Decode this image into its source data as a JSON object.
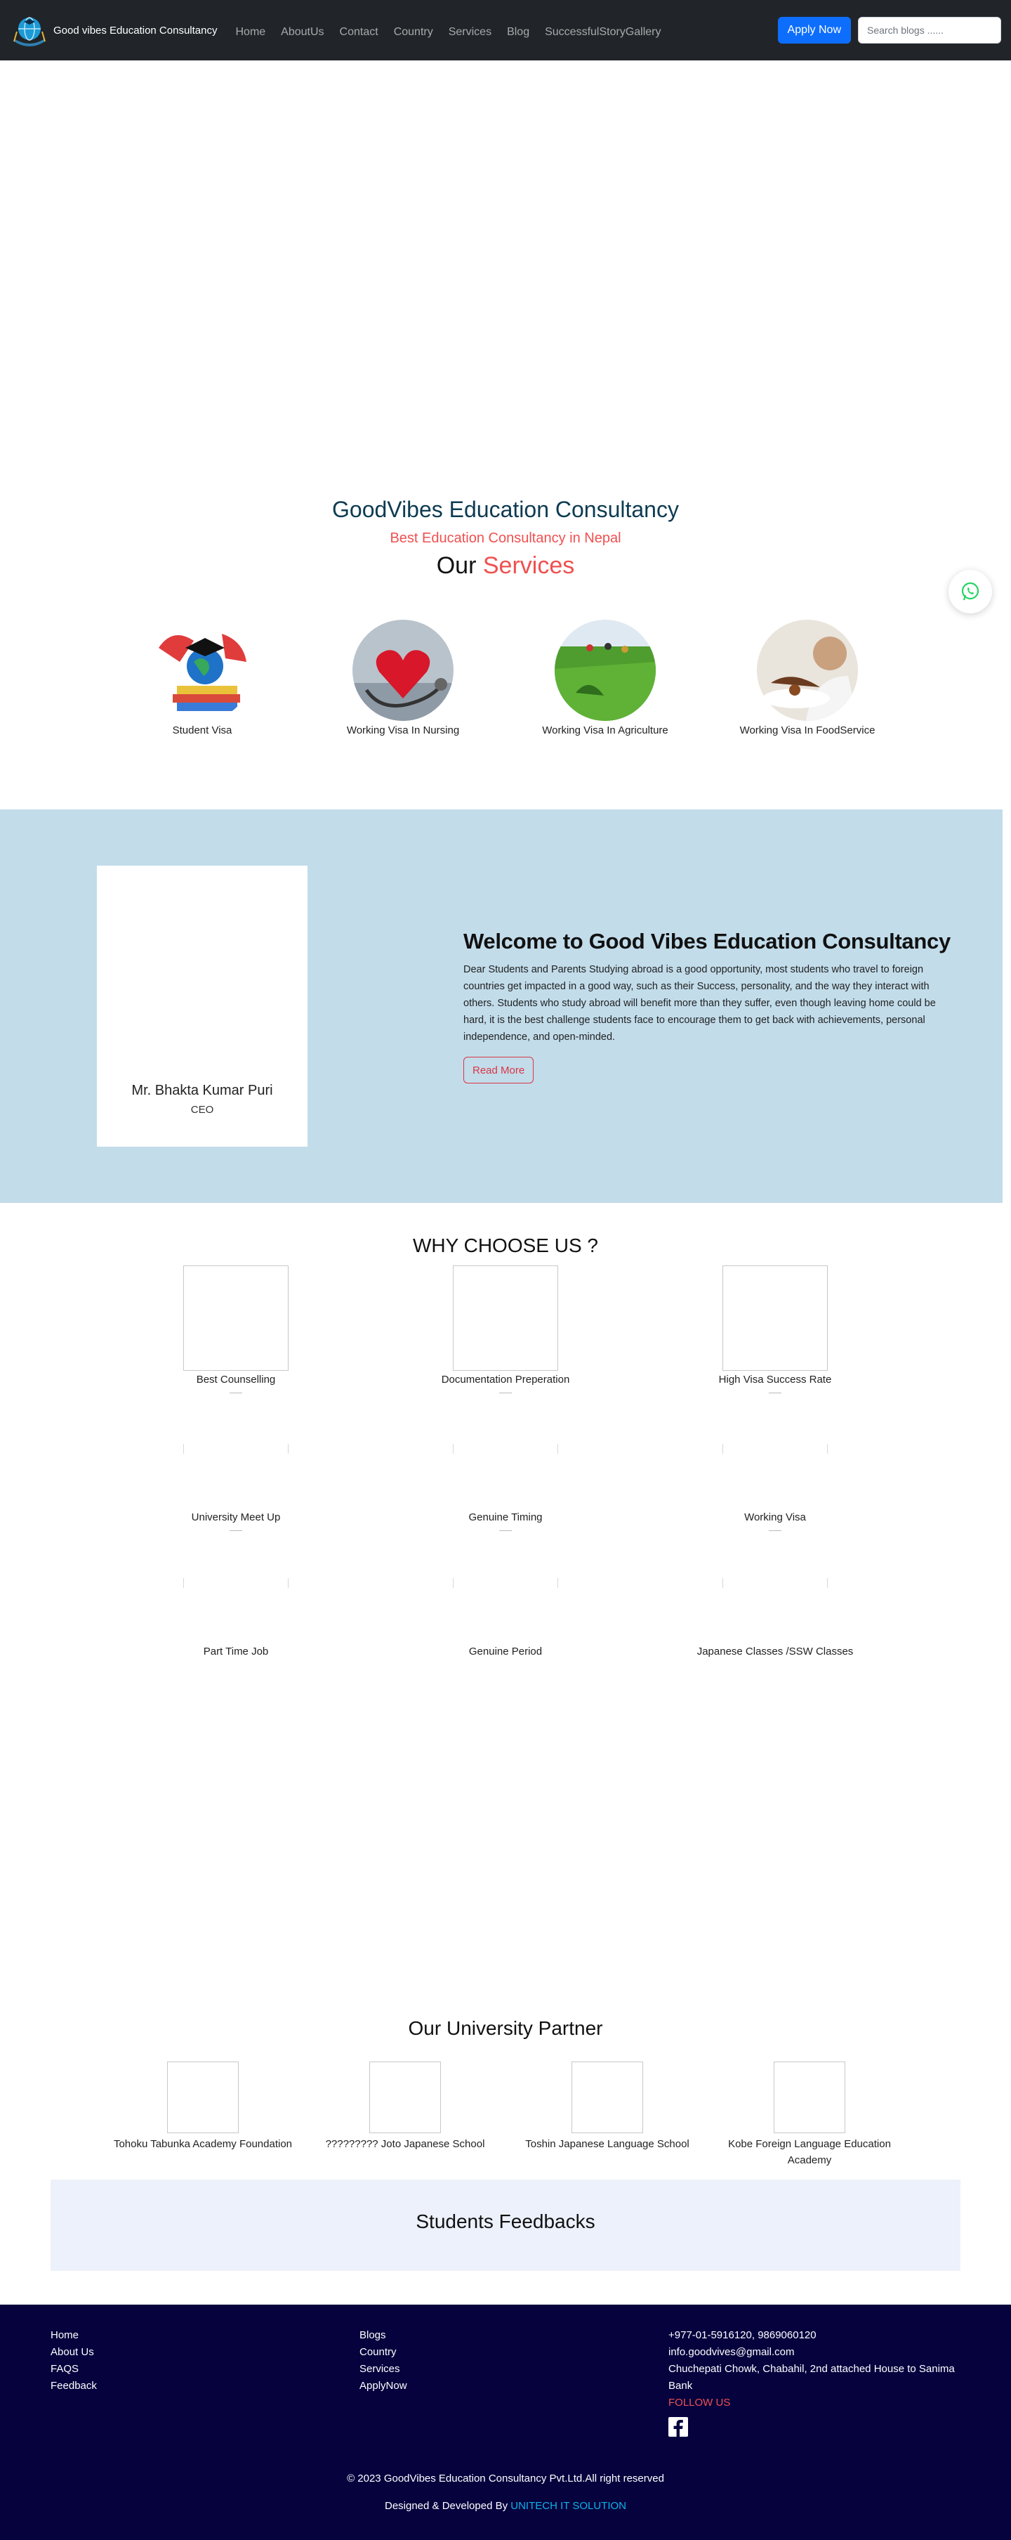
{
  "navbar": {
    "brand_name": "Good vibes Education Consultancy",
    "links": [
      "Home",
      "AboutUs",
      "Contact",
      "Country",
      "Services",
      "Blog",
      "SuccessfulStoryGallery"
    ],
    "apply_label": "Apply Now",
    "search_placeholder": "Search blogs ......",
    "colors": {
      "background": "#212529",
      "apply": "#0d6efd"
    }
  },
  "hero": {
    "title": "GoodVibes Education Consultancy",
    "subtitle": "Best Education Consultancy in Nepal"
  },
  "services": {
    "heading_plain": "Our",
    "heading_accent": "Services",
    "items": [
      {
        "label": "Student Visa",
        "icon": "graduation-globe-image"
      },
      {
        "label": "Working Visa In Nursing",
        "icon": "heart-stethoscope-image"
      },
      {
        "label": "Working Visa In Agriculture",
        "icon": "field-harvest-image"
      },
      {
        "label": "Working Visa In FoodService",
        "icon": "chef-plating-image"
      }
    ]
  },
  "welcome": {
    "ceo_name": "Mr. Bhakta Kumar Puri",
    "ceo_role": "CEO",
    "title": "Welcome to Good Vibes Education Consultancy",
    "text": "Dear Students and Parents Studying abroad is a good opportunity, most students who travel to foreign countries get impacted in a good way, such as their Success, personality, and the way they interact with others. Students who study abroad will benefit more than they suffer, even though leaving home could be hard, it is the best challenge students face to encourage them to get back with achievements, personal independence, and open-minded.",
    "read_more": "Read More",
    "background": "#c2dcea"
  },
  "why_choose": {
    "title": "WHY CHOOSE US ?",
    "items": [
      "Best Counselling",
      "Documentation Preperation",
      "High Visa Success Rate",
      "University Meet Up",
      "Genuine Timing",
      "Working Visa",
      "Part Time Job",
      "Genuine Period",
      "Japanese Classes /SSW Classes"
    ]
  },
  "partners": {
    "title": "Our University Partner",
    "items": [
      "Tohoku Tabunka Academy Foundation",
      "????????? Joto Japanese School",
      "Toshin Japanese Language School",
      "Kobe Foreign Language Education Academy"
    ]
  },
  "feedback": {
    "title": "Students Feedbacks"
  },
  "footer": {
    "col1": [
      "Home",
      "About Us",
      "FAQS",
      "Feedback"
    ],
    "col2": [
      "Blogs",
      "Country",
      "Services",
      "ApplyNow"
    ],
    "phone": "+977-01-5916120, 9869060120",
    "email": "info.goodvives@gmail.com",
    "address": "Chuchepati Chowk, Chabahil, 2nd attached House to Sanima Bank",
    "follow": "FOLLOW US",
    "copyright": "© 2023 GoodVibes Education Consultancy Pvt.Ltd.All right reserved",
    "designed_prefix": "Designed & Developed By",
    "developer": "UNITECH IT SOLUTION",
    "background": "#05023e"
  }
}
